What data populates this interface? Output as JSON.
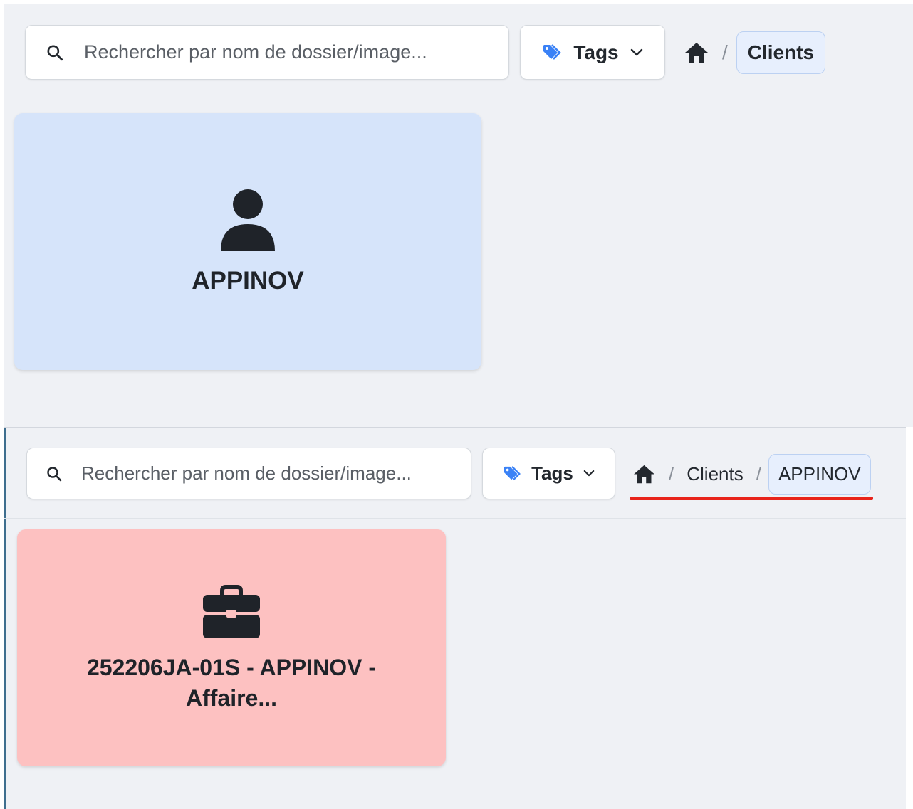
{
  "views": [
    {
      "search": {
        "placeholder": "Rechercher par nom de dossier/image..."
      },
      "tags_button": {
        "label": "Tags"
      },
      "breadcrumb": {
        "separator": "/",
        "items": [
          "Clients"
        ]
      },
      "card": {
        "title": "APPINOV",
        "icon": "user-icon",
        "color": "#d6e4fa"
      }
    },
    {
      "search": {
        "placeholder": "Rechercher par nom de dossier/image..."
      },
      "tags_button": {
        "label": "Tags"
      },
      "breadcrumb": {
        "separator": "/",
        "items": [
          "Clients",
          "APPINOV"
        ]
      },
      "card": {
        "title_line1": "252206JA-01S - APPINOV -",
        "title_line2": "Affaire...",
        "icon": "briefcase-icon",
        "color": "#fdc1c1"
      }
    }
  ],
  "colors": {
    "accent": "#3b82f6",
    "highlight": "#e8231a"
  }
}
